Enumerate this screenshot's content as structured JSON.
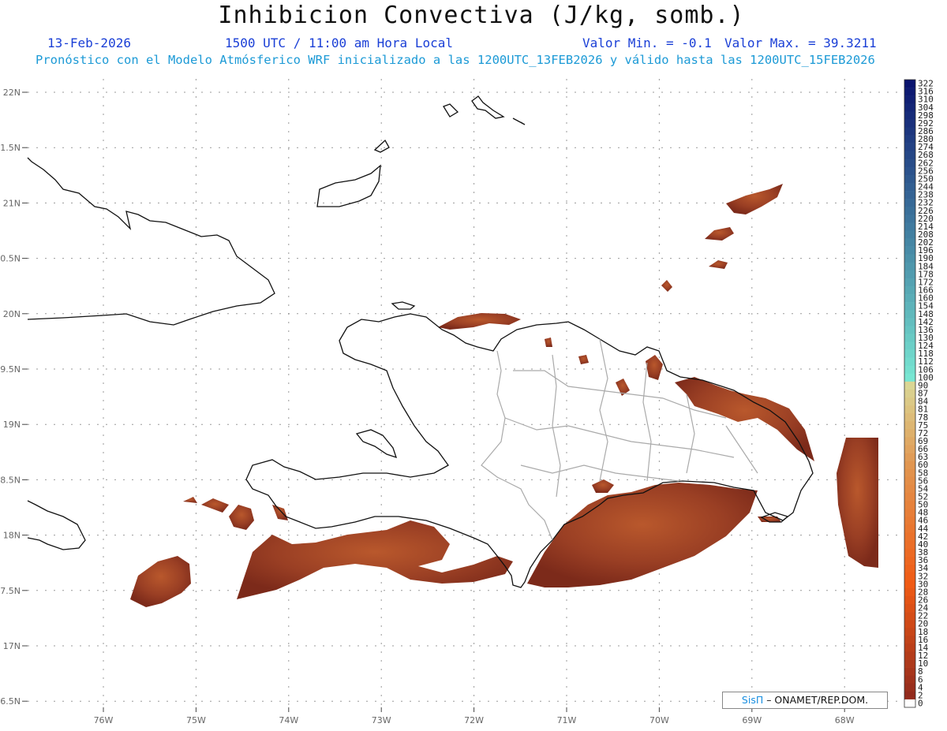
{
  "title": "Inhibicion Convectiva (J/kg, somb.)",
  "date": "13-Feb-2026",
  "time": "1500 UTC / 11:00 am Hora Local",
  "value_min": "Valor Min. = -0.1",
  "value_max": "Valor Max. = 39.3211",
  "forecast_text": "Pronóstico con el Modelo Atmósferico WRF inicializado a las 1200UTC_13FEB2026 y válido hasta las  1200UTC_15FEB2026",
  "credit": {
    "brand": "SisΠ",
    "rest": " – ONAMET/REP.DOM."
  },
  "lat_labels": [
    "22N",
    "1.5N",
    "21N",
    "0.5N",
    "20N",
    "9.5N",
    "19N",
    "8.5N",
    "18N",
    "7.5N",
    "17N",
    "6.5N"
  ],
  "lon_labels": [
    "76W",
    "75W",
    "74W",
    "73W",
    "72W",
    "71W",
    "70W",
    "69W",
    "68W"
  ],
  "colorbar": {
    "labels": [
      "322",
      "316",
      "310",
      "304",
      "298",
      "292",
      "286",
      "280",
      "274",
      "268",
      "262",
      "256",
      "250",
      "244",
      "238",
      "232",
      "226",
      "220",
      "214",
      "208",
      "202",
      "196",
      "190",
      "184",
      "178",
      "172",
      "166",
      "160",
      "154",
      "148",
      "142",
      "136",
      "130",
      "124",
      "118",
      "112",
      "106",
      "100",
      "90",
      "87",
      "84",
      "81",
      "78",
      "75",
      "72",
      "69",
      "66",
      "63",
      "60",
      "58",
      "56",
      "54",
      "52",
      "50",
      "48",
      "46",
      "44",
      "42",
      "40",
      "38",
      "36",
      "34",
      "32",
      "30",
      "28",
      "26",
      "24",
      "22",
      "20",
      "18",
      "16",
      "14",
      "12",
      "10",
      "8",
      "6",
      "4",
      "2",
      "0"
    ]
  },
  "colors": {
    "shading": "#8b3320",
    "shading_highlight": "#b7532b",
    "coast": "#111111",
    "borders": "#aaaaaa",
    "grid": "#999999"
  }
}
